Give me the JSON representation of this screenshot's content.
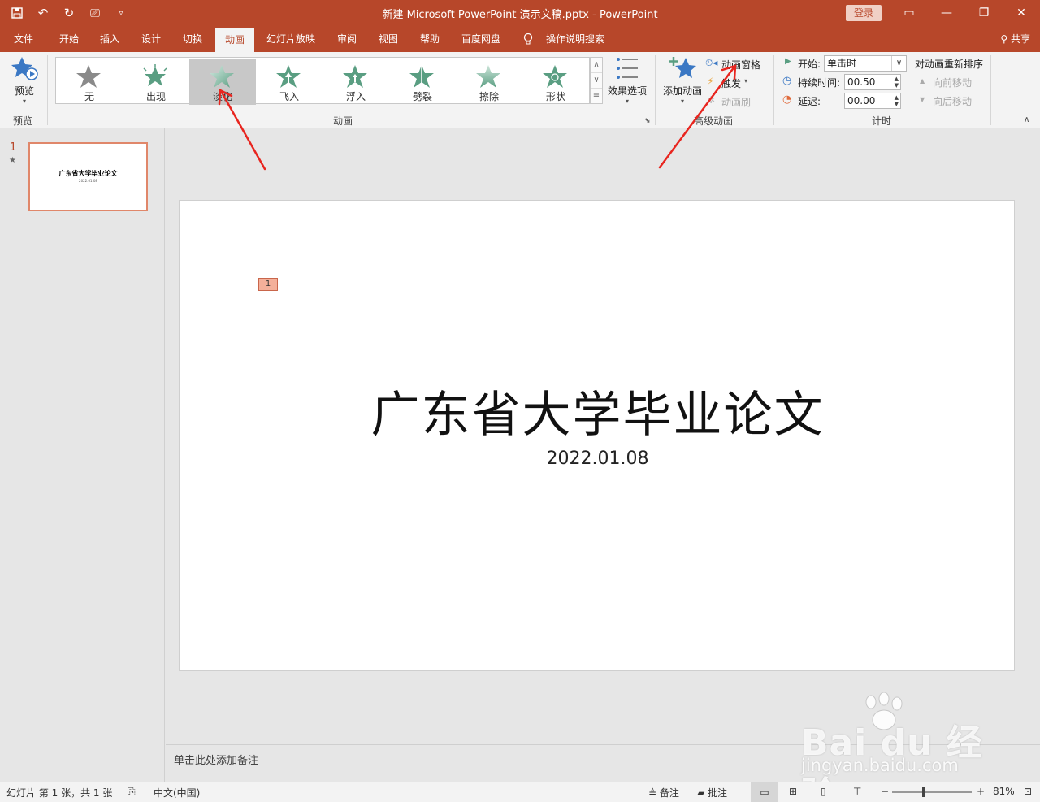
{
  "titlebar": {
    "title": "新建 Microsoft PowerPoint 演示文稿.pptx  -  PowerPoint",
    "login": "登录"
  },
  "tabs": [
    "文件",
    "开始",
    "插入",
    "设计",
    "切换",
    "动画",
    "幻灯片放映",
    "审阅",
    "视图",
    "帮助",
    "百度网盘",
    "操作说明搜索"
  ],
  "active_tab": "动画",
  "share": "共享",
  "ribbon": {
    "preview_label": "预览",
    "preview_group": "预览",
    "animation_group": "动画",
    "gallery": [
      "无",
      "出现",
      "淡化",
      "飞入",
      "浮入",
      "劈裂",
      "擦除",
      "形状"
    ],
    "selected_effect": "淡化",
    "effect_options": "效果选项",
    "add_animation": "添加动画",
    "animation_pane": "动画窗格",
    "trigger": "触发",
    "animation_painter": "动画刷",
    "advanced_group": "高级动画",
    "start_label": "开始:",
    "start_value": "单击时",
    "duration_label": "持续时间:",
    "duration_value": "00.50",
    "delay_label": "延迟:",
    "delay_value": "00.00",
    "timing_group": "计时",
    "reorder_label": "对动画重新排序",
    "move_earlier": "向前移动",
    "move_later": "向后移动"
  },
  "thumbnails": {
    "number": "1",
    "title": "广东省大学毕业论文",
    "date": "2022.01.08"
  },
  "slide": {
    "anim_tag": "1",
    "title": "广东省大学毕业论文",
    "subtitle": "2022.01.08"
  },
  "notes_placeholder": "单击此处添加备注",
  "watermark": {
    "logo": "Bai du 经验",
    "url": "jingyan.baidu.com"
  },
  "status": {
    "slide_info": "幻灯片 第 1 张，共 1 张",
    "language": "中文(中国)",
    "notes": "备注",
    "comments": "批注",
    "zoom": "81%"
  },
  "colors": {
    "accent": "#b7472a",
    "star_green": "#5a9e82",
    "star_gray": "#8a8a8a"
  }
}
